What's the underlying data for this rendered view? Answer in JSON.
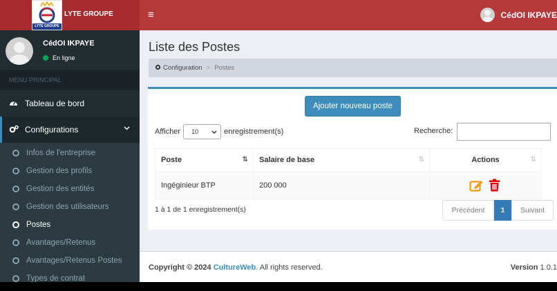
{
  "header": {
    "logo_caption": "LYTE GROUPE",
    "brand_name": "LYTE GROUPE",
    "menu_toggle": "≡",
    "user_name": "CédOI IKPAYE",
    "brand_color": "#a72b2e"
  },
  "sidebar": {
    "user_name": "CédOI IKPAYE",
    "status": "En ligne",
    "menu_header": "MENU PRINCIPAL",
    "items": [
      {
        "label": "Tableau de bord",
        "icon": "dashboard-icon"
      },
      {
        "label": "Configurations",
        "icon": "cogs-icon"
      }
    ],
    "subitems": [
      {
        "label": "Infos de l'entreprise"
      },
      {
        "label": "Gestion des profils"
      },
      {
        "label": "Gestion des entités"
      },
      {
        "label": "Gestion des utilisateurs"
      },
      {
        "label": "Postes"
      },
      {
        "label": "Avantages/Retenus"
      },
      {
        "label": "Avantages/Retenus Postes"
      },
      {
        "label": "Types de contrat"
      }
    ]
  },
  "content": {
    "title": "Liste des Postes",
    "breadcrumb": {
      "home": "Configuration",
      "separator": ">",
      "current": "Postes"
    },
    "add_button": "Ajouter nouveau poste",
    "length_label_before": "Afficher",
    "length_value": "10",
    "length_label_after": "enregistrement(s)",
    "search_label": "Recherche:",
    "search_value": "",
    "table": {
      "headers": [
        "Poste",
        "Salaire de base",
        "Actions"
      ],
      "rows": [
        {
          "poste": "Ingéginieur BTP",
          "salaire": "200 000"
        }
      ]
    },
    "info": "1 à 1 de 1 enregistrement(s)",
    "pagination": {
      "prev": "Précédent",
      "page": "1",
      "next": "Suivant"
    }
  },
  "footer": {
    "copyright": "Copyright © 2024",
    "brand": "CultureWeb",
    "rights": ". All rights reserved.",
    "version_label": "Version",
    "version_value": "1.0.1"
  }
}
